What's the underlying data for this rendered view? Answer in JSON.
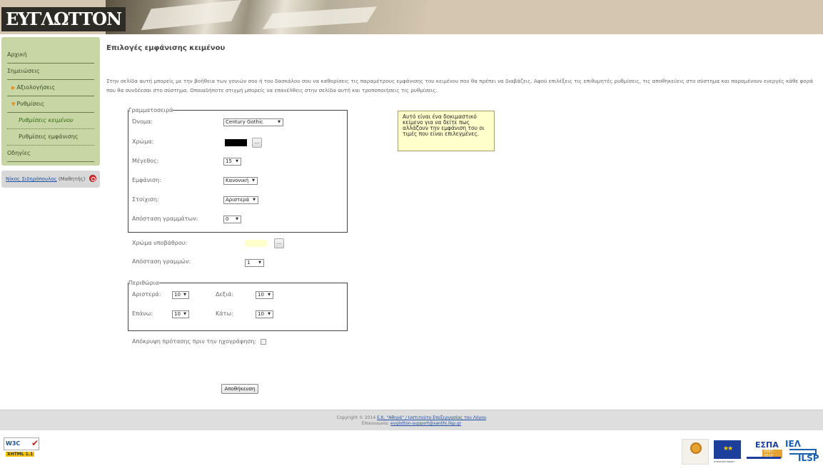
{
  "header": {
    "logo_text": "ΕΥΓΛΩΤΤΟΝ"
  },
  "sidebar": {
    "items": [
      {
        "label": "Αρχική"
      },
      {
        "label": "Σημειώσεις"
      },
      {
        "label": "Αξιολογήσεις"
      },
      {
        "label": "Ρυθμίσεις"
      },
      {
        "label": "Ρυθμίσεις κειμένου"
      },
      {
        "label": "Ρυθμίσεις εμφάνισης"
      },
      {
        "label": "Οδηγίες"
      }
    ],
    "user_name": "Νίκος Σιδηρόπουλος",
    "user_role": "(Μαθητής)"
  },
  "main": {
    "title": "Επιλογές εμφάνισης κειμένου",
    "intro": "Στην σελίδα αυτή μπορείς με την βοήθεια των γονιών σου ή του δασκάλου σου να καθορίσεις τις παραμέτρους εμφάνισης του κειμένου που θα πρέπει να διαβάζεις. Αφού επιλέξεις τις επιθυμητές ρυθμίσεις, τις αποθηκεύεις στο σύστημα και παραμένουν ενεργές κάθε φορά που θα συνδέεσαι στο σύστημα. Οποιαδήποτε στιγμή μπορείς να επανέλθεις στην σελίδα αυτή και τροποποιήσεις τις ρυθμίσεις.",
    "font_group": {
      "legend": "Γραμματοσειρά",
      "name_label": "Όνομα:",
      "name_value": "Century Gothic",
      "color_label": "Χρώμα:",
      "color_value": "#000000",
      "size_label": "Μέγεθος:",
      "size_value": "15",
      "style_label": "Εμφάνιση:",
      "style_value": "Κανονική",
      "align_label": "Στοίχιση:",
      "align_value": "Αριστερά",
      "spacing_label": "Απόσταση γραμμάτων:",
      "spacing_value": "0"
    },
    "dots_label": "...",
    "bg_color_label": "Χρώμα υποβάθρου:",
    "bg_color_value": "#ffffcc",
    "line_spacing_label": "Απόσταση γραμμών:",
    "line_spacing_value": "1",
    "margins": {
      "legend": "Περιθώρια",
      "left_label": "Αριστερά:",
      "left_value": "10",
      "right_label": "Δεξιά:",
      "right_value": "10",
      "top_label": "Επάνω:",
      "top_value": "10",
      "bottom_label": "Κάτω:",
      "bottom_value": "10"
    },
    "hide_sentence_label": "Απόκρυψη πρότασης πριν την ηχογράφηση:",
    "hide_sentence_checked": false,
    "preview_text": "Αυτό είναι ένα δοκιμαστικό κείμενο για να δείτε πως αλλάζουν την εμφάνιση του οι τιμές που είναι επιλεγμένες.",
    "save_label": "Αποθήκευση"
  },
  "footer": {
    "copyright_prefix": "Copyright © 2014",
    "copyright_link": "Ε.Κ. \"Αθηνά\" / Ινστιτούτο Επεξεργασίας του Λόγου",
    "contact_prefix": "Επικοινωνία:",
    "contact_email": "evglotton-support@xanthi.ilsp.gr"
  },
  "badges": {
    "w3c_text": "W3C",
    "xhtml_text": "XHTML 1.1",
    "espa_text": "ΕΣΠΑ",
    "espa_years": "2007-2013",
    "eu_caption": "ΕΥΡΩΠΑΪΚΗ ΕΝΩΣΗ",
    "iel_text": "ΙΕΛ",
    "ilsp_text": "ILSP"
  }
}
